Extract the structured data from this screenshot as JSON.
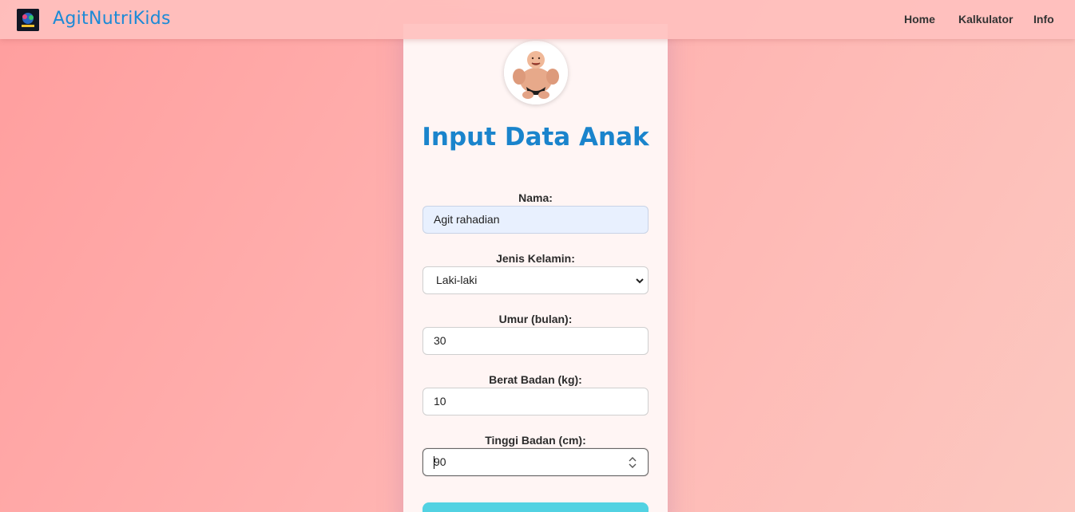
{
  "navbar": {
    "brand": "AgitNutriKids",
    "links": [
      "Home",
      "Kalkulator",
      "Info"
    ]
  },
  "form": {
    "title": "Input Data Anak",
    "fields": {
      "nama": {
        "label": "Nama:",
        "value": "Agit rahadian"
      },
      "jenis_kelamin": {
        "label": "Jenis Kelamin:",
        "value": "Laki-laki"
      },
      "umur": {
        "label": "Umur (bulan):",
        "value": "30"
      },
      "berat": {
        "label": "Berat Badan (kg):",
        "value": "10"
      },
      "tinggi": {
        "label": "Tinggi Badan (cm):",
        "value": "90"
      }
    }
  },
  "colors": {
    "brand": "#1c8ad6",
    "title": "#1a84cc",
    "button": "#52d2e2"
  },
  "icons": {
    "select": "chevron-down-icon",
    "number": "spinner-icon"
  }
}
